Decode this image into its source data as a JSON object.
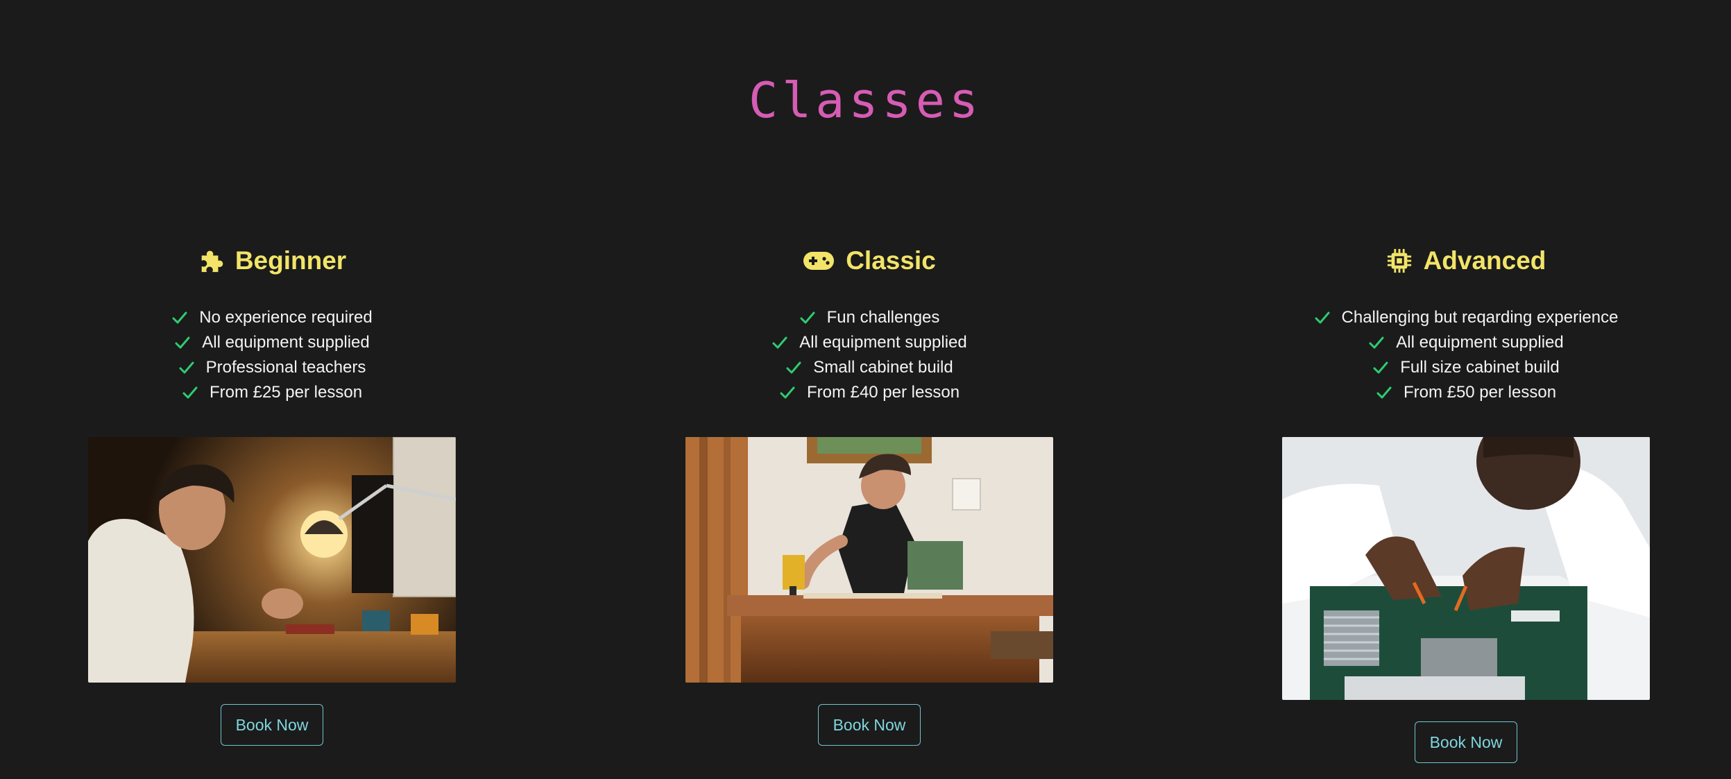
{
  "page": {
    "title": "Classes"
  },
  "colors": {
    "background": "#1b1b1b",
    "title": "#d65cb4",
    "card_heading": "#f2e468",
    "check": "#2ecc71",
    "button_border": "#6fc6cf",
    "button_text": "#7fd6de"
  },
  "classes": [
    {
      "name": "Beginner",
      "icon": "puzzle-piece-icon",
      "features": [
        "No experience required",
        "All equipment supplied",
        "Professional teachers",
        "From £25 per lesson"
      ],
      "image": "child-soldering-at-desk-lamp",
      "button_label": "Book Now"
    },
    {
      "name": "Classic",
      "icon": "gamepad-icon",
      "features": [
        "Fun challenges",
        "All equipment supplied",
        "Small cabinet build",
        "From £40 per lesson"
      ],
      "image": "man-drilling-at-workbench",
      "button_label": "Book Now"
    },
    {
      "name": "Advanced",
      "icon": "microchip-icon",
      "features": [
        "Challenging but reqarding experience",
        "All equipment supplied",
        "Full size cabinet build",
        "From £50 per lesson"
      ],
      "image": "technician-working-on-circuit-board",
      "button_label": "Book Now"
    }
  ]
}
